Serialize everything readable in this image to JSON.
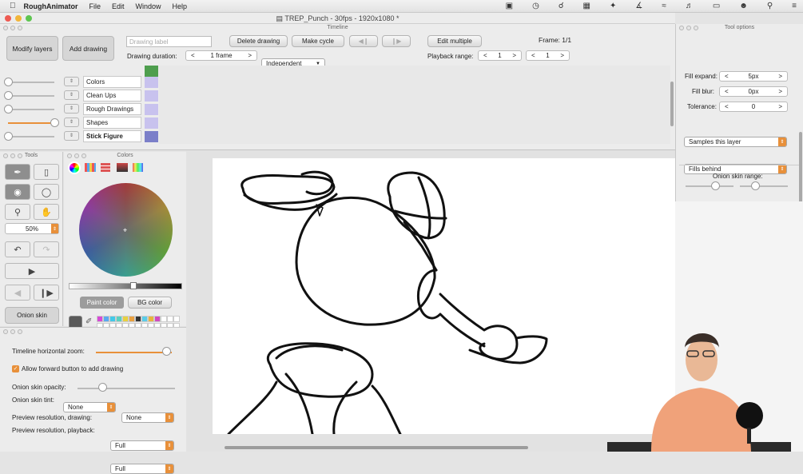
{
  "menubar": {
    "app_name": "RoughAnimator",
    "items": [
      "File",
      "Edit",
      "Window",
      "Help"
    ]
  },
  "window": {
    "title": "TREP_Punch - 30fps - 1920x1080 *"
  },
  "timeline": {
    "panel_title": "Timeline",
    "modify_layers": "Modify layers",
    "add_drawing": "Add drawing",
    "drawing_label_placeholder": "Drawing label",
    "delete_drawing": "Delete drawing",
    "make_cycle": "Make cycle",
    "edit_multiple": "Edit multiple",
    "frame_label": "Frame: 1/1",
    "drawing_duration_label": "Drawing duration:",
    "duration_value": "1 frame",
    "duration_mode": "Independent",
    "playback_range_label": "Playback range:",
    "range_start": "1",
    "range_end": "1",
    "layers": [
      {
        "name": "Colors",
        "bold": false,
        "color": "#c8c2ee"
      },
      {
        "name": "Clean Ups",
        "bold": false,
        "color": "#c8c2ee"
      },
      {
        "name": "Rough Drawings",
        "bold": false,
        "color": "#c8c2ee"
      },
      {
        "name": "Shapes",
        "bold": false,
        "color": "#c8c2ee"
      },
      {
        "name": "Stick Figure",
        "bold": true,
        "color": "#7b7fc9"
      }
    ],
    "layer_opacity": [
      0.0,
      0.0,
      0.0,
      1.0,
      0.0
    ]
  },
  "tool_options": {
    "panel_title": "Tool options",
    "fill_expand_label": "Fill expand:",
    "fill_expand_value": "5px",
    "fill_blur_label": "Fill blur:",
    "fill_blur_value": "0px",
    "tolerance_label": "Tolerance:",
    "tolerance_value": "0",
    "sample_mode": "Samples this layer",
    "fill_mode": "Fills behind",
    "onion_range_label": "Onion skin range:"
  },
  "tools": {
    "panel_title": "Tools",
    "zoom_value": "50%",
    "onion_skin": "Onion skin",
    "icons": [
      "brush-icon",
      "eraser-icon",
      "fill-bucket-icon",
      "lasso-icon",
      "zoom-icon",
      "hand-icon",
      "undo-icon",
      "redo-icon",
      "play-icon",
      "prev-frame-icon",
      "next-frame-icon"
    ]
  },
  "colors": {
    "panel_title": "Colors",
    "paint_color": "Paint color",
    "bg_color": "BG color",
    "current_color": "#5a5a5a",
    "swatches": [
      "#d64ad6",
      "#5aa9f0",
      "#42c8e8",
      "#5ad0c0",
      "#e8d040",
      "#e8a040",
      "#333333",
      "#5acce8",
      "#e8b43c",
      "#d04ac0",
      "#ffffff",
      "#ffffff",
      "#ffffff"
    ]
  },
  "settings": {
    "timeline_zoom_label": "Timeline horizontal zoom:",
    "timeline_zoom_value": 0.93,
    "allow_forward_label": "Allow forward button to add drawing",
    "allow_forward_checked": true,
    "onion_opacity_label": "Onion skin opacity:",
    "onion_opacity_value": 0.25,
    "onion_tint_label": "Onion skin tint:",
    "tint_a": "None",
    "tint_b": "None",
    "preview_drawing_label": "Preview resolution, drawing:",
    "preview_drawing_value": "Full",
    "preview_playback_label": "Preview resolution, playback:",
    "preview_playback_value": "Full"
  }
}
